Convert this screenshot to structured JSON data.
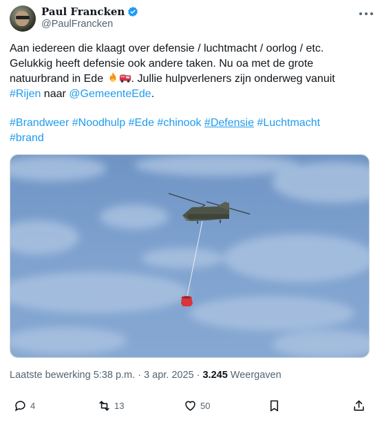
{
  "author": {
    "display_name": "Paul Francken",
    "handle": "@PaulFrancken"
  },
  "tweet": {
    "line1": "Aan iedereen die klaagt over defensie / luchtmacht / oorlog / etc.",
    "line2": "Gelukkig heeft defensie ook andere taken. Nu oa met de grote",
    "line3_pre": "natuurbrand in Ede ",
    "line3_post": ". Jullie hulpverleners zijn onderweg vanuit",
    "mention_rijen": "#Rijen",
    "naar": " naar ",
    "mention_gemeente": "@GemeenteEde",
    "end": "."
  },
  "hashtags": [
    "#Brandweer",
    "#Noodhulp",
    "#Ede",
    "#chinook",
    "#Defensie",
    "#Luchtmacht",
    "#brand"
  ],
  "meta": {
    "edited": "Laatste bewerking 5:38 p.m. · 3 apr. 2025 ·",
    "views_count": "3.245",
    "views_label": "Weergaven"
  },
  "actions": {
    "replies": "4",
    "reposts": "13",
    "likes": "50"
  },
  "icons": [
    "verified-icon",
    "more-icon",
    "fire-icon",
    "fire-truck-icon",
    "reply-icon",
    "repost-icon",
    "like-icon",
    "bookmark-icon",
    "share-icon"
  ],
  "colors": {
    "link": "#1d9bf0",
    "secondary": "#536471",
    "text": "#0f1419"
  }
}
